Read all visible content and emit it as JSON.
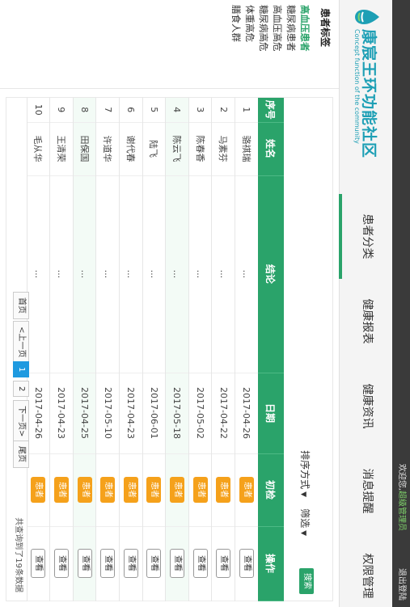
{
  "topbar": {
    "welcome_prefix": "欢迎您,",
    "user": "超级管理员",
    "logout": "退出登陆"
  },
  "logo": {
    "name": "康宸王环功能社区",
    "subtitle": "Concept function of the community"
  },
  "nav": [
    {
      "label": "患者分类",
      "active": true
    },
    {
      "label": "健康报表",
      "active": false
    },
    {
      "label": "健康资讯",
      "active": false
    },
    {
      "label": "消息提醒",
      "active": false
    },
    {
      "label": "权限管理",
      "active": false
    }
  ],
  "sidebar": {
    "title": "患者标签",
    "items": [
      {
        "label": "高血压患者",
        "active": true
      },
      {
        "label": "糖尿病患者",
        "active": false
      },
      {
        "label": "高血压高危",
        "active": false
      },
      {
        "label": "糖尿病高危",
        "active": false
      },
      {
        "label": "体重高危",
        "active": false
      },
      {
        "label": "膳食人群",
        "active": false
      }
    ]
  },
  "toolbar": {
    "sort_label": "排序方式",
    "filter_label": "筛选",
    "search_button": "搜索"
  },
  "table": {
    "headers": [
      "序号",
      "姓名",
      "结论",
      "日期",
      "初检",
      "操作"
    ],
    "rows": [
      {
        "no": "1",
        "name": "骆祺瑞",
        "conclusion": "...",
        "date": "2017-04-26",
        "check": "患者",
        "action": "查看"
      },
      {
        "no": "2",
        "name": "马素芬",
        "conclusion": "...",
        "date": "2017-04-22",
        "check": "患者",
        "action": "查看"
      },
      {
        "no": "3",
        "name": "陈春香",
        "conclusion": "...",
        "date": "2017-05-02",
        "check": "患者",
        "action": "查看"
      },
      {
        "no": "4",
        "name": "陈云飞",
        "conclusion": "...",
        "date": "2017-05-18",
        "check": "患者",
        "action": "查看"
      },
      {
        "no": "5",
        "name": "陆飞",
        "conclusion": "...",
        "date": "2017-06-01",
        "check": "患者",
        "action": "查看"
      },
      {
        "no": "6",
        "name": "谢代春",
        "conclusion": "...",
        "date": "2017-04-23",
        "check": "患者",
        "action": "查看"
      },
      {
        "no": "7",
        "name": "许道华",
        "conclusion": "...",
        "date": "2017-05-10",
        "check": "患者",
        "action": "查看"
      },
      {
        "no": "8",
        "name": "田保国",
        "conclusion": "...",
        "date": "2017-04-25",
        "check": "患者",
        "action": "查看"
      },
      {
        "no": "9",
        "name": "王清荣",
        "conclusion": "...",
        "date": "2017-04-23",
        "check": "患者",
        "action": "查看"
      },
      {
        "no": "10",
        "name": "毛从华",
        "conclusion": "...",
        "date": "2017-04-26",
        "check": "患者",
        "action": "查看"
      }
    ]
  },
  "pager": {
    "first": "首页",
    "prev": "<上一页",
    "pages": [
      "1",
      "2"
    ],
    "current": "1",
    "next": "下一页>",
    "last": "尾页",
    "total": "共查询到了19条数据"
  },
  "colors": {
    "accent_green": "#2aa36a",
    "badge_orange": "#f5a11b",
    "pager_blue": "#1e9ae0",
    "logo_teal": "#1d9fb5"
  }
}
